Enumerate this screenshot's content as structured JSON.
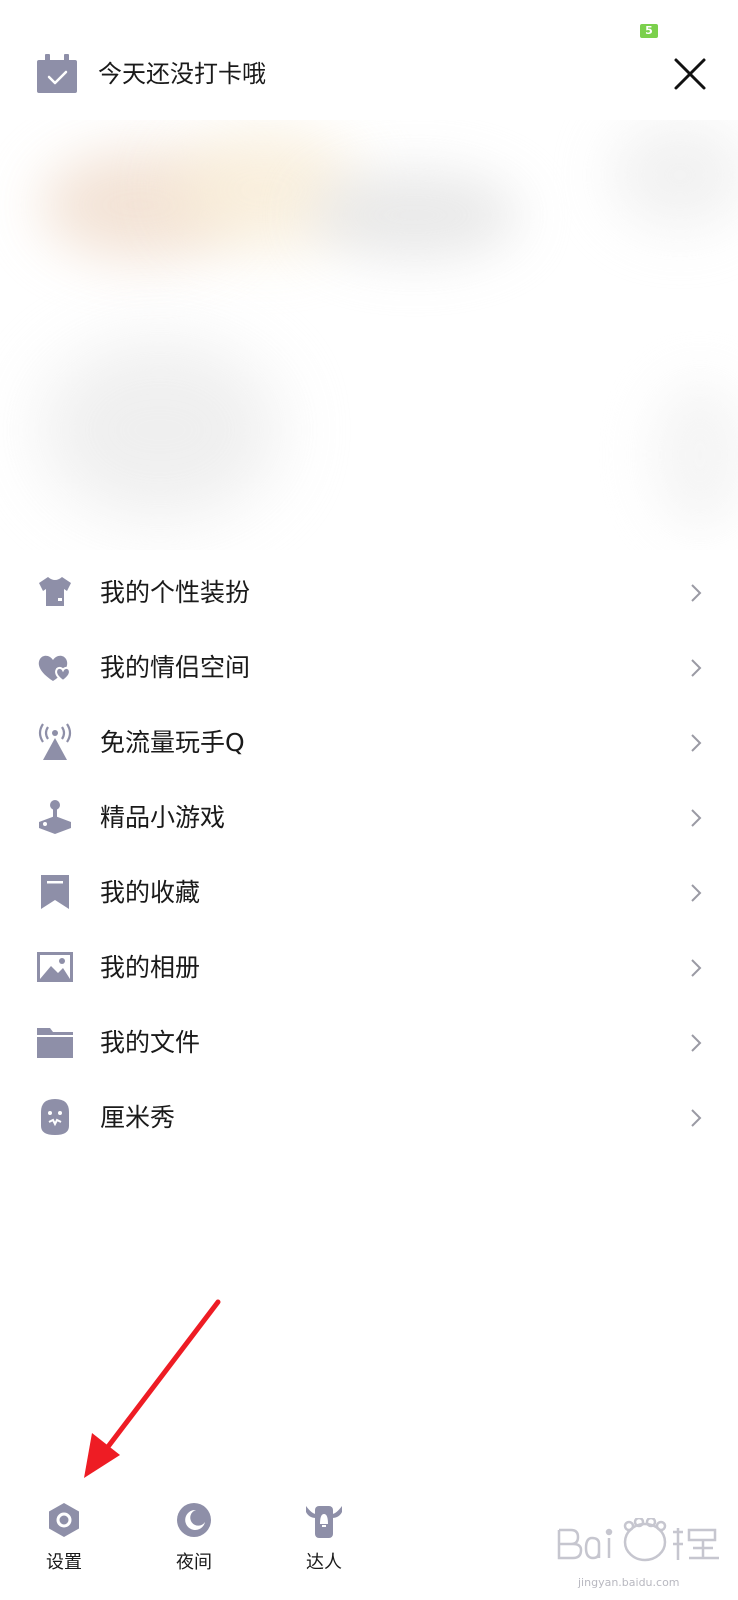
{
  "status": {
    "badge": "5"
  },
  "header": {
    "checkin_text": "今天还没打卡哦",
    "close_icon": "close-icon"
  },
  "menu": {
    "items": [
      {
        "label": "我的个性装扮",
        "icon": "tshirt-icon"
      },
      {
        "label": "我的情侣空间",
        "icon": "hearts-icon"
      },
      {
        "label": "免流量玩手Q",
        "icon": "signal-tower-icon"
      },
      {
        "label": "精品小游戏",
        "icon": "joystick-icon"
      },
      {
        "label": "我的收藏",
        "icon": "bookmark-icon"
      },
      {
        "label": "我的相册",
        "icon": "image-icon"
      },
      {
        "label": "我的文件",
        "icon": "folder-icon"
      },
      {
        "label": "厘米秀",
        "icon": "avatar-face-icon"
      }
    ]
  },
  "bottom_bar": {
    "settings_label": "设置",
    "night_label": "夜间",
    "expert_label": "达人"
  },
  "watermark": {
    "text": "jingyan.baidu.com"
  },
  "colors": {
    "icon_gray": "#8e8fa8",
    "badge_green": "#7bd04c",
    "arrow_red": "#ee1c24"
  }
}
